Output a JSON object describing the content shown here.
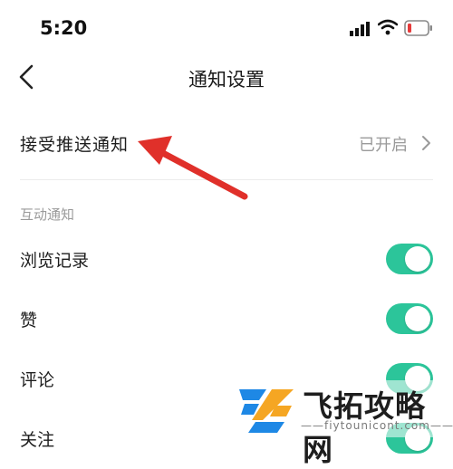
{
  "status_bar": {
    "time": "5:20"
  },
  "nav": {
    "title": "通知设置"
  },
  "push": {
    "label": "接受推送通知",
    "value": "已开启"
  },
  "section": {
    "title": "互动通知"
  },
  "toggles": [
    {
      "label": "浏览记录",
      "on": true
    },
    {
      "label": "赞",
      "on": true
    },
    {
      "label": "评论",
      "on": true
    },
    {
      "label": "关注",
      "on": true
    }
  ],
  "colors": {
    "accent": "#2cc59a",
    "arrow": "#e0302a",
    "battery_low": "#e63a3a"
  },
  "icons": [
    "signal-icon",
    "wifi-icon",
    "battery-icon",
    "back-icon",
    "chevron-right-icon",
    "arrow-annotation-icon",
    "watermark-logo"
  ],
  "watermark": {
    "title": "飞拓攻略网",
    "subtitle": "——fiytounicont.com——"
  }
}
